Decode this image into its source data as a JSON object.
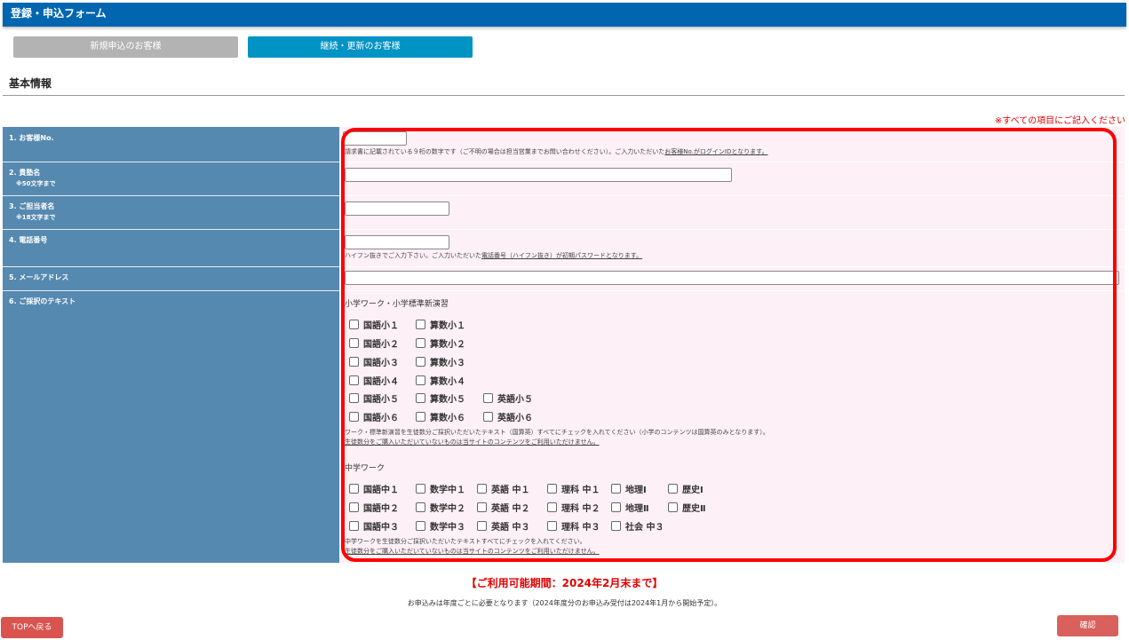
{
  "header": {
    "title": "登録・申込フォーム"
  },
  "customer_type": {
    "new_label": "新規申込のお客様",
    "renew_label": "継続・更新のお客様"
  },
  "section": {
    "title": "基本情報",
    "required_note": "※すべての項目にご記入ください"
  },
  "fields": {
    "customer_no": {
      "label": "1. お客様No.",
      "value": "",
      "note": "請求書に記載されている９桁の数字です（ご不明の場合は担当営業までお問い合わせください）。ご入力いただいた",
      "note_link": "お客様No.がログインIDとなります。"
    },
    "school_name": {
      "label": "2. 貴塾名",
      "sub": "※50文字まで",
      "value": ""
    },
    "contact_name": {
      "label": "3. ご担当者名",
      "sub": "※18文字まで",
      "value": ""
    },
    "phone": {
      "label": "4. 電話番号",
      "value": "",
      "note": "ハイフン抜きでご入力下さい。ご入力いただいた",
      "note_link": "電話番号（ハイフン抜き）が初期パスワードとなります。"
    },
    "email": {
      "label": "5. メールアドレス",
      "value": ""
    },
    "texts": {
      "label": "6. ご採択のテキスト",
      "elementary": {
        "title": "小学ワーク・小学標準新演習",
        "rows": [
          [
            "国語小１",
            "算数小１"
          ],
          [
            "国語小２",
            "算数小２"
          ],
          [
            "国語小３",
            "算数小３"
          ],
          [
            "国語小４",
            "算数小４"
          ],
          [
            "国語小５",
            "算数小５",
            "英語小５"
          ],
          [
            "国語小６",
            "算数小６",
            "英語小６"
          ]
        ],
        "note1": "ワーク・標準新演習を生徒数分ご採択いただいたテキスト（国算英）すべてにチェックを入れてください（小学のコンテンツは国算英のみとなります）。",
        "note2": "生徒数分をご購入いただいていないものは当サイトのコンテンツをご利用いただけません。"
      },
      "junior": {
        "title": "中学ワーク",
        "rows": [
          [
            "国語中１",
            "数学中１",
            "英語 中１",
            "理科 中１",
            "地理Ⅰ",
            "歴史Ⅰ"
          ],
          [
            "国語中２",
            "数学中２",
            "英語 中２",
            "理科 中２",
            "地理Ⅱ",
            "歴史Ⅱ"
          ],
          [
            "国語中３",
            "数学中３",
            "英語 中３",
            "理科 中３",
            "社会 中３"
          ]
        ],
        "note1": "中学ワークを生徒数分ご採択いただいたテキストすべてにチェックを入れてください。",
        "note2": "生徒数分をご購入いただいていないものは当サイトのコンテンツをご利用いただけません。"
      }
    }
  },
  "footer": {
    "period": "【ご利用可能期間：2024年2月末まで】",
    "renew_note": "お申込みは年度ごとに必要となります（2024年度分のお申込み受付は2024年1月から開始予定）。",
    "top_button": "TOPへ戻る",
    "confirm_button": "確認"
  },
  "colors": {
    "header_bg": "#0066b0",
    "label_bg": "#5589b0",
    "input_bg": "#fdf0f6",
    "required": "#e00000",
    "highlight": "#ff0000"
  }
}
